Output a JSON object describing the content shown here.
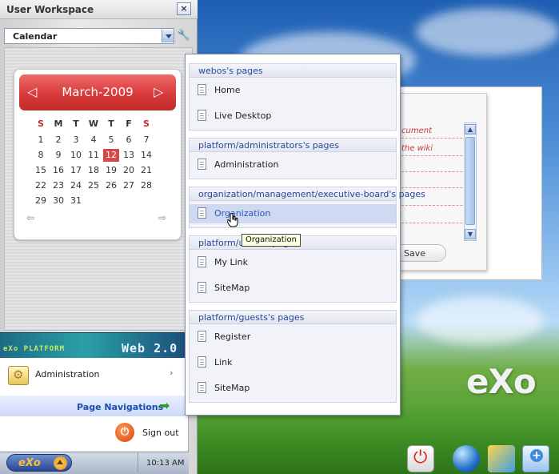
{
  "workspace": {
    "title": "User Workspace",
    "close_glyph": "×",
    "selector_value": "Calendar",
    "wrench_glyph": "🔧"
  },
  "calendar": {
    "month_label": "March-2009",
    "prev_glyph": "◁",
    "next_glyph": "▷",
    "weekdays": [
      "S",
      "M",
      "T",
      "W",
      "T",
      "F",
      "S"
    ],
    "weekday_colors": [
      "#c02a2a",
      "#333333",
      "#333333",
      "#333333",
      "#333333",
      "#333333",
      "#c02a2a"
    ],
    "weeks": [
      [
        "1",
        "2",
        "3",
        "4",
        "5",
        "6",
        "7"
      ],
      [
        "8",
        "9",
        "10",
        "11",
        "12",
        "13",
        "14"
      ],
      [
        "15",
        "16",
        "17",
        "18",
        "19",
        "20",
        "21"
      ],
      [
        "22",
        "23",
        "24",
        "25",
        "26",
        "27",
        "28"
      ],
      [
        "29",
        "30",
        "31",
        "",
        "",
        "",
        ""
      ]
    ],
    "today": "12",
    "footer_prev_glyph": "⇦",
    "footer_next_glyph": "⇨"
  },
  "banner": {
    "logo_text": "eXo PLATFORM",
    "web_text": "Web 2.0"
  },
  "start_menu": {
    "admin_label": "Administration",
    "admin_chevron": "›",
    "page_nav_label": "Page Navigations",
    "page_nav_arrow": "➡",
    "signout_label": "Sign out",
    "signout_glyph": "⏻"
  },
  "taskbar": {
    "start_label": "eXo",
    "clock": "10:13 AM"
  },
  "wiki_widget": {
    "lines": [
      "cument",
      "the wiki"
    ],
    "save_label": "Save",
    "scroll_up_glyph": "▲",
    "scroll_down_glyph": "▼"
  },
  "desktop": {
    "logo": "eXo"
  },
  "page_navigations": {
    "groups": [
      {
        "title": "webos's pages",
        "items": [
          "Home",
          "Live Desktop"
        ]
      },
      {
        "title": "platform/administrators's pages",
        "items": [
          "Administration"
        ]
      },
      {
        "title": "organization/management/executive-board's pages",
        "items": [
          "Organization"
        ]
      },
      {
        "title": "platform/users's pages",
        "items": [
          "My Link",
          "SiteMap"
        ]
      },
      {
        "title": "platform/guests's pages",
        "items": [
          "Register",
          "Link",
          "SiteMap"
        ]
      }
    ],
    "active_item": "Organization",
    "tooltip": "Organization"
  },
  "colors": {
    "accent_blue": "#1d4fb0",
    "calendar_red": "#d83a3a",
    "nav_active_bg": "#cfd9f2"
  }
}
